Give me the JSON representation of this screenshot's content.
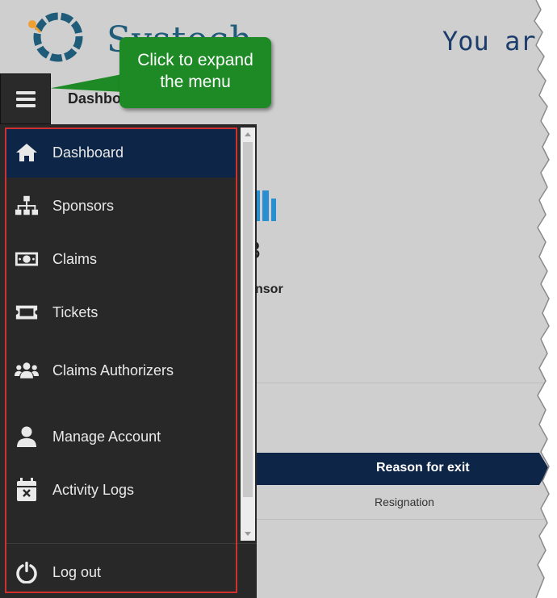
{
  "header": {
    "logo_text": "Systech",
    "welcome_text": "You ar",
    "page_title": "Dashbo"
  },
  "callout": {
    "line1": "Click to expand",
    "line2": "the menu",
    "color": "#1e8a25"
  },
  "menu_toggle": {
    "icon": "hamburger-icon"
  },
  "sidebar": {
    "active_color": "#0d2547",
    "items": [
      {
        "label": "Dashboard",
        "icon": "home-icon",
        "active": true
      },
      {
        "label": "Sponsors",
        "icon": "sitemap-icon",
        "active": false
      },
      {
        "label": "Claims",
        "icon": "money-bill-icon",
        "active": false
      },
      {
        "label": "Tickets",
        "icon": "ticket-icon",
        "active": false
      },
      {
        "label": "Claims Authorizers",
        "icon": "users-icon",
        "active": false
      },
      {
        "label": "Manage Account",
        "icon": "user-icon",
        "active": false
      },
      {
        "label": "Activity Logs",
        "icon": "calendar-x-icon",
        "active": false
      }
    ],
    "logout": {
      "label": "Log out",
      "icon": "power-icon"
    }
  },
  "dashboard_bg": {
    "stat_value": "3",
    "stat_label": "nsor",
    "table": {
      "header": "Reason for exit",
      "cell": "Resignation"
    }
  }
}
